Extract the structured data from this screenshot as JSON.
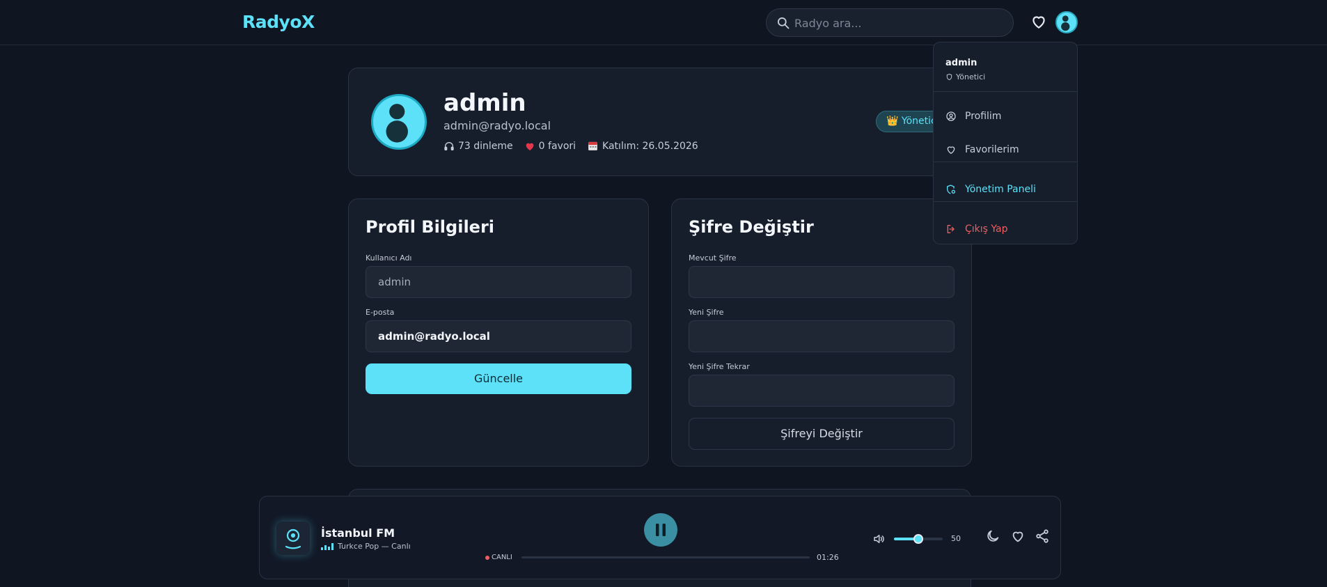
{
  "header": {
    "logo": "RadyoX",
    "search_placeholder": "Radyo ara..."
  },
  "profile": {
    "username": "admin",
    "email": "admin@radyo.local",
    "stats": {
      "listens": "73 dinleme",
      "favorites": "0 favori",
      "joined": "Katılım: 26.05.2026"
    },
    "role_badge": "👑 Yönetici"
  },
  "profile_form": {
    "title": "Profil Bilgileri",
    "username_label": "Kullanıcı Adı",
    "username_value": "admin",
    "email_label": "E-posta",
    "email_value": "admin@radyo.local",
    "submit_label": "Güncelle"
  },
  "password_form": {
    "title": "Şifre Değiştir",
    "current_label": "Mevcut Şifre",
    "new_label": "Yeni Şifre",
    "confirm_label": "Yeni Şifre Tekrar",
    "submit_label": "Şifreyi Değiştir"
  },
  "user_menu": {
    "name": "admin",
    "role": "Yönetici",
    "items": [
      {
        "label": "Profilim",
        "icon": "user-circle-icon"
      },
      {
        "label": "Favorilerim",
        "icon": "heart-icon"
      },
      {
        "label": "Yönetim Paneli",
        "icon": "shield-settings-icon"
      },
      {
        "label": "Çıkış Yap",
        "icon": "logout-icon"
      }
    ]
  },
  "player": {
    "station": "İstanbul FM",
    "subtitle": "Turkce Pop — Canlı",
    "live_label": "CANLI",
    "elapsed": "01:26",
    "volume": 50,
    "volume_label": "50",
    "state": "playing"
  },
  "colors": {
    "accent": "#5ce1f8",
    "background": "#0f1521",
    "card": "#171e2b",
    "danger": "#ef5f5f"
  }
}
